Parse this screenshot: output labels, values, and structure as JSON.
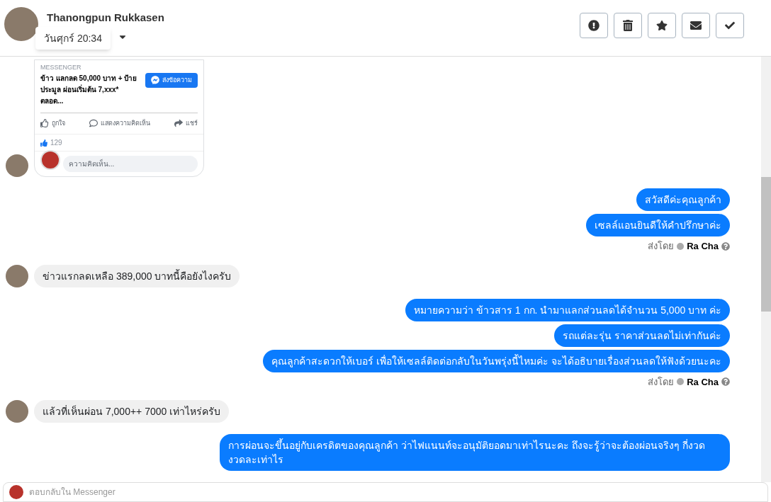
{
  "header": {
    "name": "Thanongpun Rukkasen",
    "tooltip": "วันศุกร์ 20:34"
  },
  "toolbar": [
    {
      "kind": "spam"
    },
    {
      "kind": "delete"
    },
    {
      "kind": "star"
    },
    {
      "kind": "unread"
    },
    {
      "kind": "done"
    }
  ],
  "card": {
    "source": "MESSENGER",
    "title": "ข้าว แลกลด  50,000 บาท + ป้าย ประมูล ผ่อนเริ่มต้น 7,xxx* ตลอด...",
    "button": "ส่งข้อความ",
    "actions": [
      "ถูกใจ",
      "แสดงความคิดเห็น",
      "แชร์"
    ],
    "likes": "129",
    "comment_placeholder": "ความคิดเห็น..."
  },
  "messages": [
    {
      "kind": "outgoing",
      "texts": [
        "สวัสดีค่ะคุณลูกค้า",
        "เซลล์แอนยินดีให้คำปรึกษาค่ะ"
      ],
      "sent_by_label": "ส่งโดย",
      "sender": "Ra Cha"
    },
    {
      "kind": "incoming",
      "texts": [
        "ข่าวแรกลดเหลือ 389,000 บาทนี้คือยังไงครับ"
      ]
    },
    {
      "kind": "outgoing",
      "texts": [
        "หมายความว่า ข้าวสาร 1 กก. นำมาแลกส่วนลดได้จำนวน 5,000 บาท ค่ะ",
        "รถแต่ละรุ่น ราคาส่วนลดไม่เท่ากันค่ะ",
        "คุณลูกค้าสะดวกให้เบอร์ เพื่อให้เซลล์ติดต่อกลับในวันพรุ่งนี้ไหมค่ะ จะได้อธิบายเรื่องส่วนลดให้ฟังด้วยนะคะ"
      ],
      "sent_by_label": "ส่งโดย",
      "sender": "Ra Cha"
    },
    {
      "kind": "incoming",
      "texts": [
        "แล้วที่เห็นผ่อน 7,000++   7000 เท่าไหร่ครับ"
      ]
    },
    {
      "kind": "outgoing",
      "texts": [
        "การผ่อนจะขึ้นอยู่กับเครดิตของคุณลูกค้า ว่าไฟแนนท์จะอนุมัติยอดมาเท่าไรนะคะ ถึงจะรู้ว่าจะต้องผ่อนจริงๆ กี่งวด งวดละเท่าไร"
      ]
    }
  ],
  "reply": {
    "placeholder": "ตอบกลับใน Messenger"
  }
}
